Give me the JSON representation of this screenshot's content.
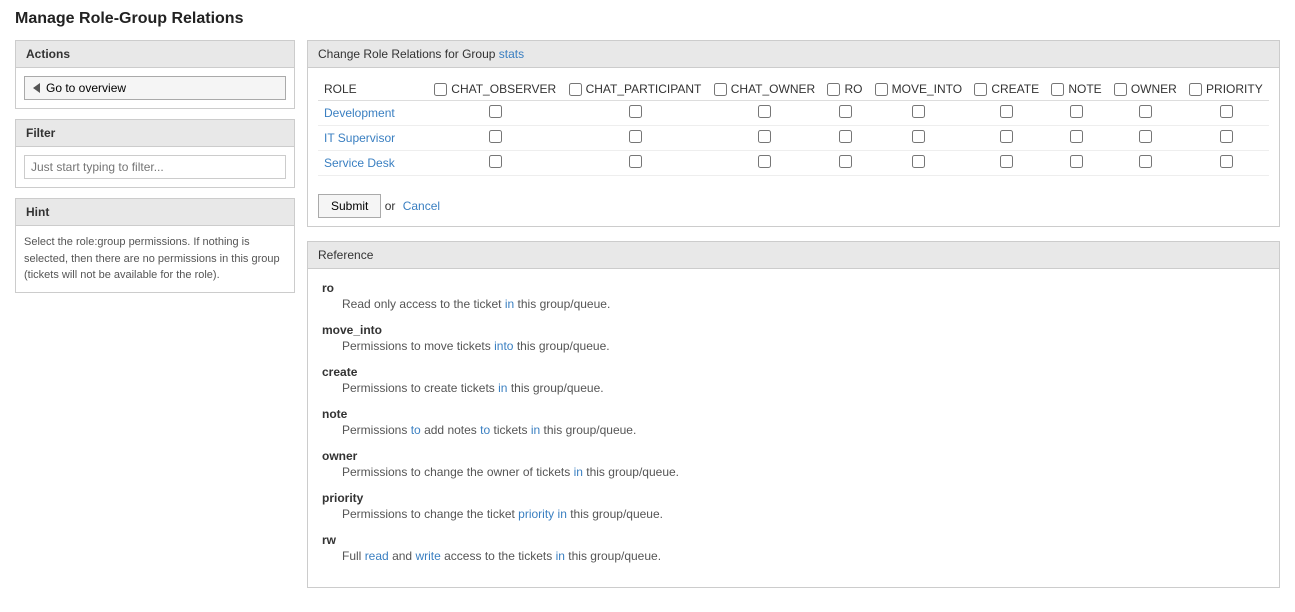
{
  "page": {
    "title": "Manage Role-Group Relations"
  },
  "sidebar": {
    "actions_header": "Actions",
    "go_to_overview_label": "Go to overview",
    "filter_header": "Filter",
    "filter_placeholder": "Just start typing to filter...",
    "hint_header": "Hint",
    "hint_text": "Select the role:group permissions. If nothing is selected, then there are no permissions in this group (tickets will not be available for the role)."
  },
  "main": {
    "change_role_header": "Change Role Relations for Group",
    "group_name": "stats",
    "columns": {
      "role": "ROLE",
      "chat_observer": "CHAT_OBSERVER",
      "chat_participant": "CHAT_PARTICIPANT",
      "chat_owner": "CHAT_OWNER",
      "ro": "RO",
      "move_into": "MOVE_INTO",
      "create": "CREATE",
      "note": "NOTE",
      "owner": "OWNER",
      "priority": "PRIORITY"
    },
    "roles": [
      {
        "name": "Development"
      },
      {
        "name": "IT Supervisor"
      },
      {
        "name": "Service Desk"
      }
    ],
    "submit_label": "Submit",
    "or_text": "or",
    "cancel_label": "Cancel"
  },
  "reference": {
    "header": "Reference",
    "items": [
      {
        "term": "ro",
        "desc_parts": [
          {
            "text": "Read only access to the ticket ",
            "highlight": false
          },
          {
            "text": "in this group/queue.",
            "highlight": false
          }
        ]
      },
      {
        "term": "move_into",
        "desc_parts": [
          {
            "text": "Permissions to move tickets into ",
            "highlight": false
          },
          {
            "text": "this group/queue.",
            "highlight": false
          }
        ]
      },
      {
        "term": "create",
        "desc_parts": [
          {
            "text": "Permissions to create tickets ",
            "highlight": false
          },
          {
            "text": "in this group/queue.",
            "highlight": false
          }
        ]
      },
      {
        "term": "note",
        "desc_parts": [
          {
            "text": "Permissions to add notes to tickets ",
            "highlight": false
          },
          {
            "text": "in this group/queue.",
            "highlight": false
          }
        ]
      },
      {
        "term": "owner",
        "desc_parts": [
          {
            "text": "Permissions to change the owner of tickets ",
            "highlight": false
          },
          {
            "text": "in this group/queue.",
            "highlight": false
          }
        ]
      },
      {
        "term": "priority",
        "desc_parts": [
          {
            "text": "Permissions to change the ticket priority ",
            "highlight": false
          },
          {
            "text": "in this group/queue.",
            "highlight": false
          }
        ]
      },
      {
        "term": "rw",
        "desc_parts": [
          {
            "text": "Full read and write access to the tickets ",
            "highlight": false
          },
          {
            "text": "in this group/queue.",
            "highlight": false
          }
        ]
      }
    ]
  }
}
